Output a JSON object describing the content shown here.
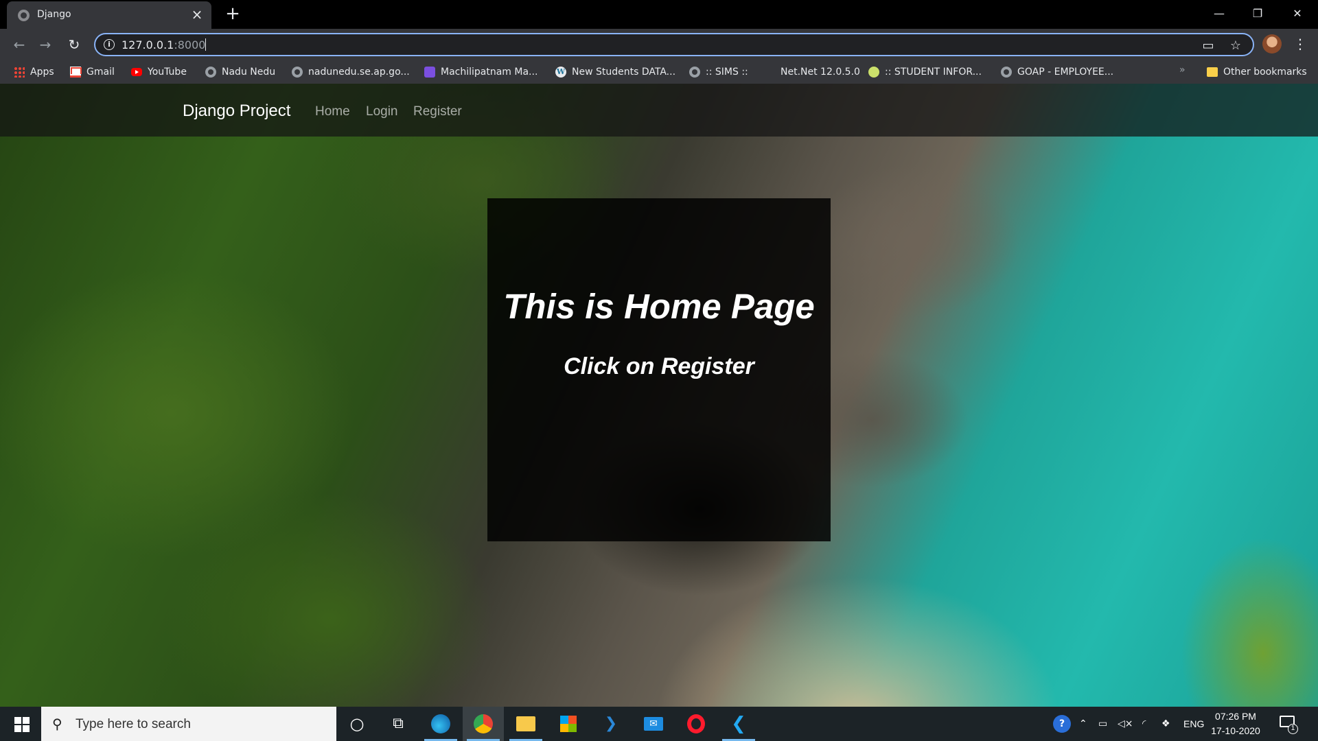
{
  "browser": {
    "tab": {
      "title": "Django"
    },
    "address": {
      "host": "127.0.0.1",
      "port": ":8000"
    },
    "window_controls": {
      "minimize": "—",
      "restore": "❐",
      "close": "✕"
    },
    "bookmarks": [
      {
        "label": "Apps",
        "icon": "apps-grid-icon"
      },
      {
        "label": "Gmail",
        "icon": "gmail-icon"
      },
      {
        "label": "YouTube",
        "icon": "youtube-icon"
      },
      {
        "label": "Nadu Nedu",
        "icon": "globe-icon"
      },
      {
        "label": "nadunedu.se.ap.go...",
        "icon": "globe-icon"
      },
      {
        "label": "Machilipatnam Ma...",
        "icon": "purple-app-icon"
      },
      {
        "label": "New Students DATA...",
        "icon": "wordpress-icon"
      },
      {
        "label": ":: SIMS ::",
        "icon": "globe-icon"
      },
      {
        "label": "Net.Net 12.0.5.0",
        "icon": ""
      },
      {
        "label": ":: STUDENT INFOR...",
        "icon": "green-circle-icon"
      },
      {
        "label": "GOAP - EMPLOYEE...",
        "icon": "globe-icon"
      }
    ],
    "bookmarks_more": "»",
    "other_bookmarks": "Other bookmarks"
  },
  "site": {
    "brand": "Django Project",
    "nav": [
      "Home",
      "Login",
      "Register"
    ],
    "hero": {
      "title": "This is Home Page",
      "subtitle": "Click on Register"
    }
  },
  "taskbar": {
    "search_placeholder": "Type here to search",
    "apps": [
      "cortana",
      "task-view",
      "edge",
      "chrome",
      "file-explorer",
      "microsoft-store",
      "power-automate",
      "mail",
      "opera",
      "vscode"
    ],
    "tray": {
      "language": "ENG"
    },
    "clock": {
      "time": "07:26 PM",
      "date": "17-10-2020"
    },
    "notification_count": "1"
  },
  "colors": {
    "accent_focus": "#8ab4f8",
    "chrome_toolbar": "#35363a",
    "taskbar": "#1c2327",
    "hero_box": "rgba(0,0,0,0.83)"
  }
}
